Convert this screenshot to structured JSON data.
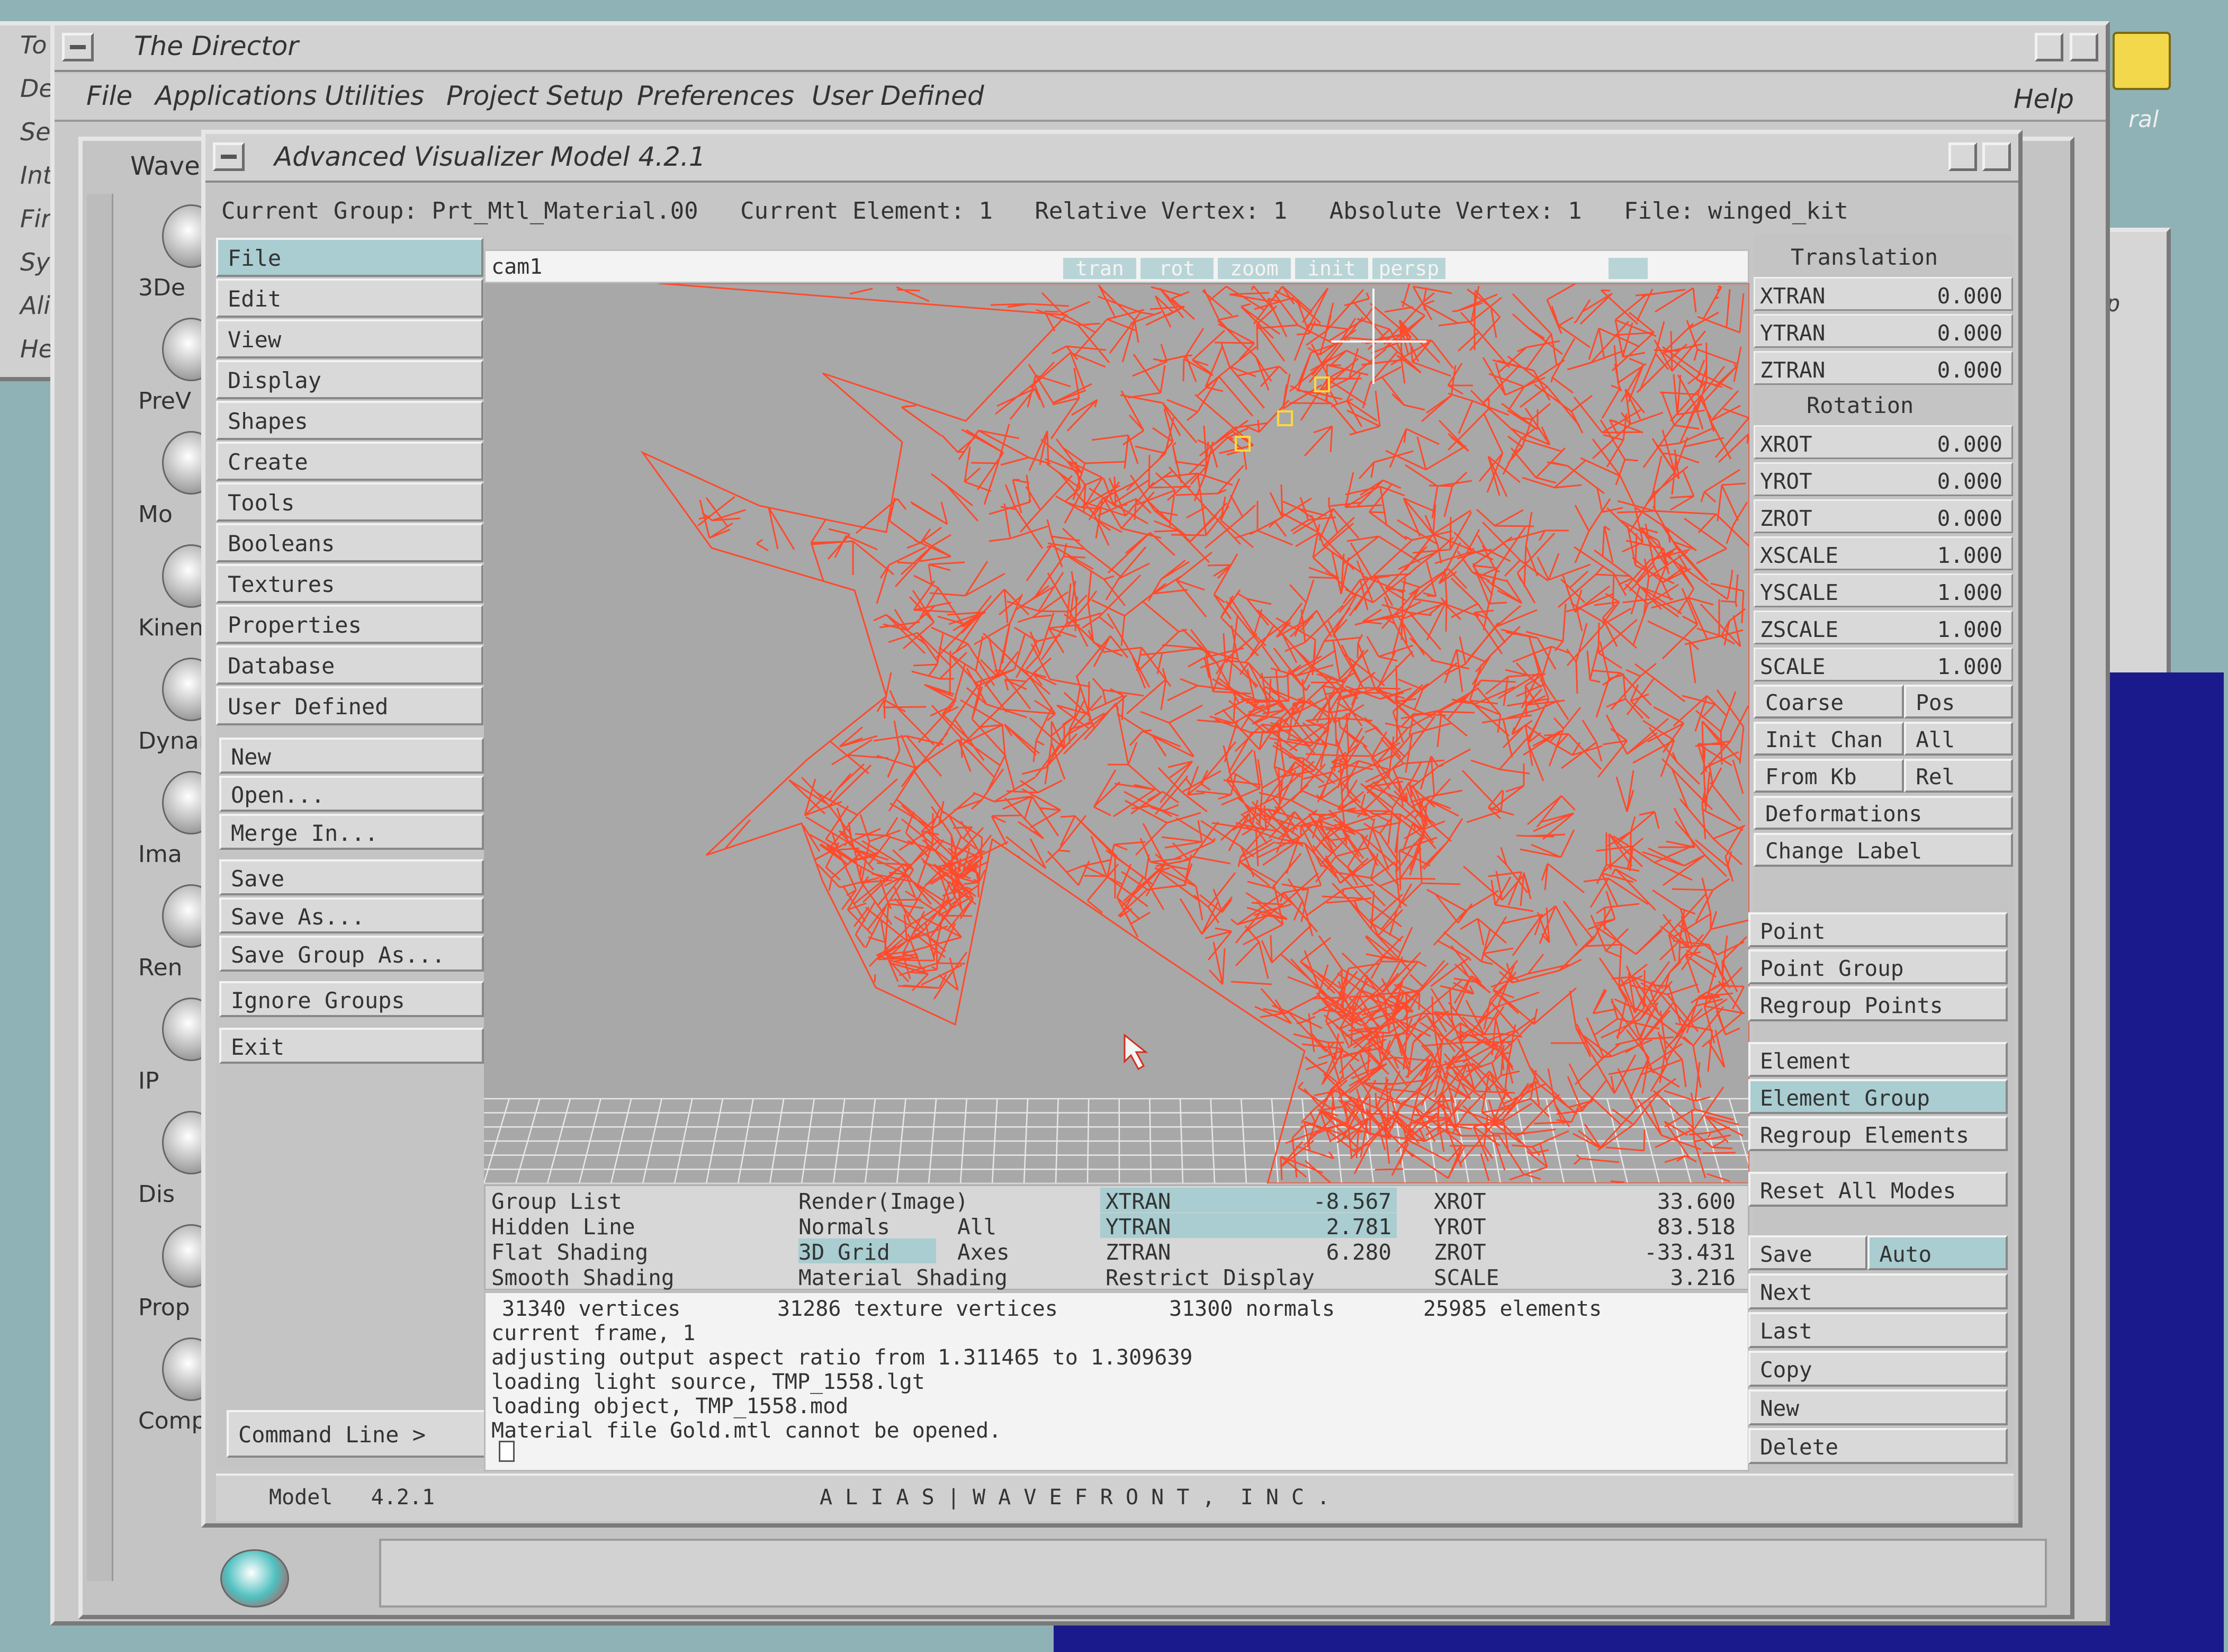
{
  "desktop": {
    "left_window_items": [
      "To",
      "De",
      "Se",
      "Int",
      "Fir",
      "Sy",
      "Ali",
      "He"
    ],
    "toolbox_labels": [
      "Wave",
      "3De",
      "PreV",
      "Mo",
      "Kinem",
      "Dynan",
      "Ima",
      "Ren",
      "IP",
      "Dis",
      "Prop",
      "Comp"
    ],
    "right_fragment_text": "ral",
    "right_fragment_text2": "p"
  },
  "director": {
    "title": "The Director",
    "menu": [
      "File",
      "Applications",
      "Utilities",
      "Project Setup",
      "Preferences",
      "User Defined"
    ],
    "help": "Help"
  },
  "avm": {
    "title": "Advanced Visualizer Model 4.2.1",
    "status_line": "Current Group: Prt_Mtl_Material.00   Current Element: 1   Relative Vertex: 1   Absolute Vertex: 1   File: winged_kit",
    "left_menu": [
      "File",
      "Edit",
      "View",
      "Display",
      "Shapes",
      "Create",
      "Tools",
      "Booleans",
      "Textures",
      "Properties",
      "Database",
      "User Defined"
    ],
    "file_menu": [
      "New",
      "Open...",
      "Merge In...",
      "Save",
      "Save As...",
      "Save Group As...",
      "Ignore Groups",
      "Exit"
    ],
    "command_line": "Command Line >",
    "footer_version": "Model   4.2.1",
    "footer_company": "A L I A S | W A V E F R O N T ,  I N C .",
    "viewport": {
      "camera": "cam1",
      "tabs": [
        "tran",
        "rot",
        "zoom",
        "init",
        "persp"
      ]
    },
    "transform": {
      "translation_label": "Translation",
      "rotation_label": "Rotation",
      "fields": [
        {
          "label": "XTRAN",
          "value": "0.000"
        },
        {
          "label": "YTRAN",
          "value": "0.000"
        },
        {
          "label": "ZTRAN",
          "value": "0.000"
        },
        {
          "label": "XROT",
          "value": "0.000"
        },
        {
          "label": "YROT",
          "value": "0.000"
        },
        {
          "label": "ZROT",
          "value": "0.000"
        },
        {
          "label": "XSCALE",
          "value": "1.000"
        },
        {
          "label": "YSCALE",
          "value": "1.000"
        },
        {
          "label": "ZSCALE",
          "value": "1.000"
        },
        {
          "label": "SCALE",
          "value": "1.000"
        }
      ],
      "coarse": "Coarse",
      "pos": "Pos",
      "init_chan": "Init Chan",
      "all": "All",
      "from_kb": "From Kb",
      "rel": "Rel",
      "deformations": "Deformations",
      "change_label": "Change Label"
    },
    "modes": [
      "Point",
      "Point Group",
      "Regroup Points",
      "Element",
      "Element Group",
      "Regroup Elements",
      "Reset All Modes"
    ],
    "bottom_right": {
      "save": "Save",
      "auto": "Auto",
      "items": [
        "Next",
        "Last",
        "Copy",
        "New",
        "Delete"
      ]
    },
    "display_grid": [
      {
        "a": "Group List",
        "b": "Render(Image)",
        "c": "XTRAN",
        "cv": "-8.567",
        "d": "XROT",
        "dv": "33.600"
      },
      {
        "a": "Hidden Line",
        "b": "Normals",
        "b2": "All",
        "c": "YTRAN",
        "cv": "2.781",
        "d": "YROT",
        "dv": "83.518"
      },
      {
        "a": "Flat Shading",
        "b": "3D Grid",
        "b2": "Axes",
        "c": "ZTRAN",
        "cv": "6.280",
        "d": "ZROT",
        "dv": "-33.431"
      },
      {
        "a": "Smooth Shading",
        "b": "Material Shading",
        "c": "Restrict Display",
        "d": "SCALE",
        "dv": "3.216"
      }
    ],
    "stats": {
      "vertices": "31340 vertices",
      "texture_vertices": "31286 texture vertices",
      "normals": "31300 normals",
      "elements": "25985 elements"
    },
    "log": [
      "current frame, 1",
      "adjusting output aspect ratio from 1.311465 to 1.309639",
      "loading light source, TMP_1558.lgt",
      "loading object, TMP_1558.mod",
      "Material file Gold.mtl cannot be opened."
    ]
  },
  "colors": {
    "wireframe": "#ff4a2c",
    "viewport_bg": "#a8a8a8",
    "selected": "#a9cdd0",
    "panel": "#c9c9c9"
  }
}
